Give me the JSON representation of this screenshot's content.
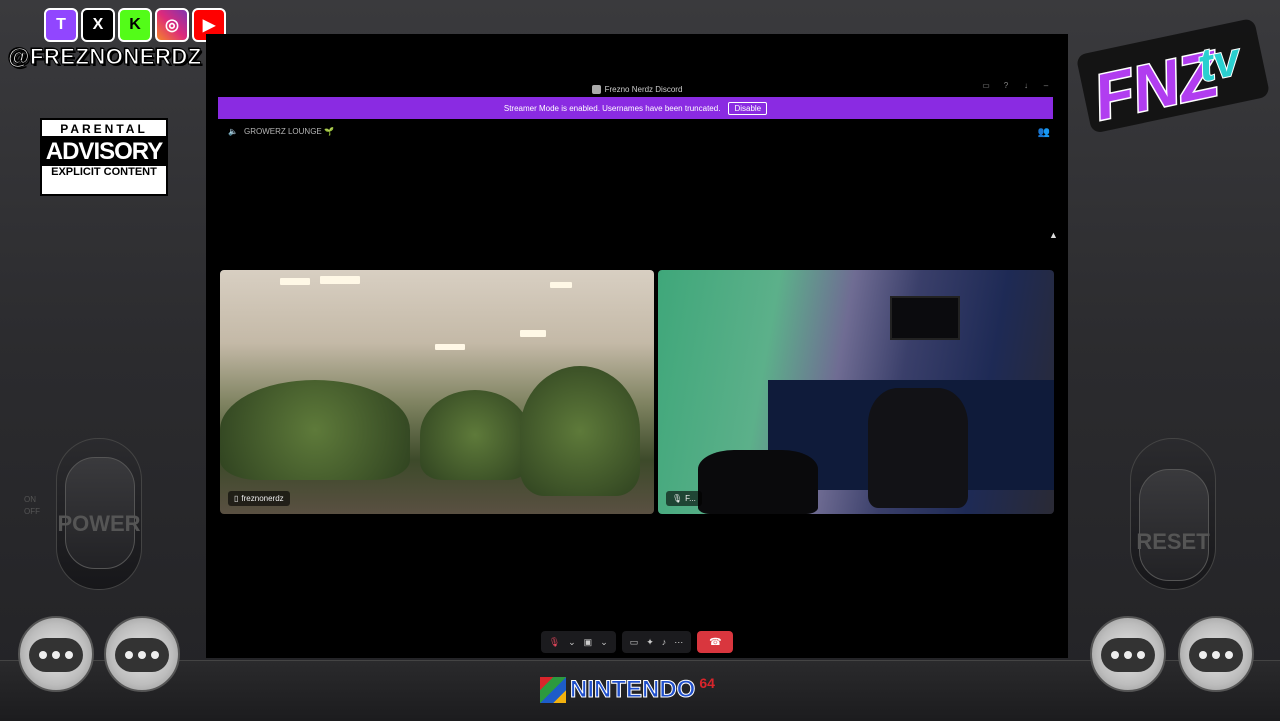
{
  "overlay": {
    "social_icons": [
      "twitch-icon",
      "x-icon",
      "kick-icon",
      "instagram-icon",
      "youtube-icon"
    ],
    "social_glyphs": [
      "T",
      "X",
      "K",
      "◎",
      "▶"
    ],
    "handle": "@FREZNONERDZ",
    "advisory": {
      "line1": "PARENTAL",
      "line2": "ADVISORY",
      "line3": "EXPLICIT CONTENT"
    },
    "brand_logo_left": "FNZ",
    "brand_logo_right": "tv",
    "power_label": "POWER",
    "on_label": "ON",
    "off_label": "OFF",
    "reset_label": "RESET",
    "console_brand": "NINTENDO",
    "console_brand_sup": "64"
  },
  "window": {
    "title": "Frezno Nerdz Discord"
  },
  "streamer_banner": {
    "message": "Streamer Mode is enabled. Usernames have been truncated.",
    "button": "Disable"
  },
  "channel": {
    "name": "GROWERZ LOUNGE 🌱"
  },
  "tiles": [
    {
      "user": "freznonerdz",
      "icon": "phone-icon"
    },
    {
      "user": "F...",
      "icon": "mic-muted-icon"
    }
  ],
  "controls": {
    "groups": [
      [
        "mic-muted-icon",
        "chevron-down-icon",
        "camera-off-icon",
        "chevron-down-icon"
      ],
      [
        "screen-share-icon",
        "activities-icon",
        "soundboard-icon",
        "more-icon"
      ]
    ],
    "leave": "leave-call-icon"
  },
  "colors": {
    "banner": "#8a2be2",
    "leave": "#d9363e",
    "muted": "#e0455a"
  }
}
